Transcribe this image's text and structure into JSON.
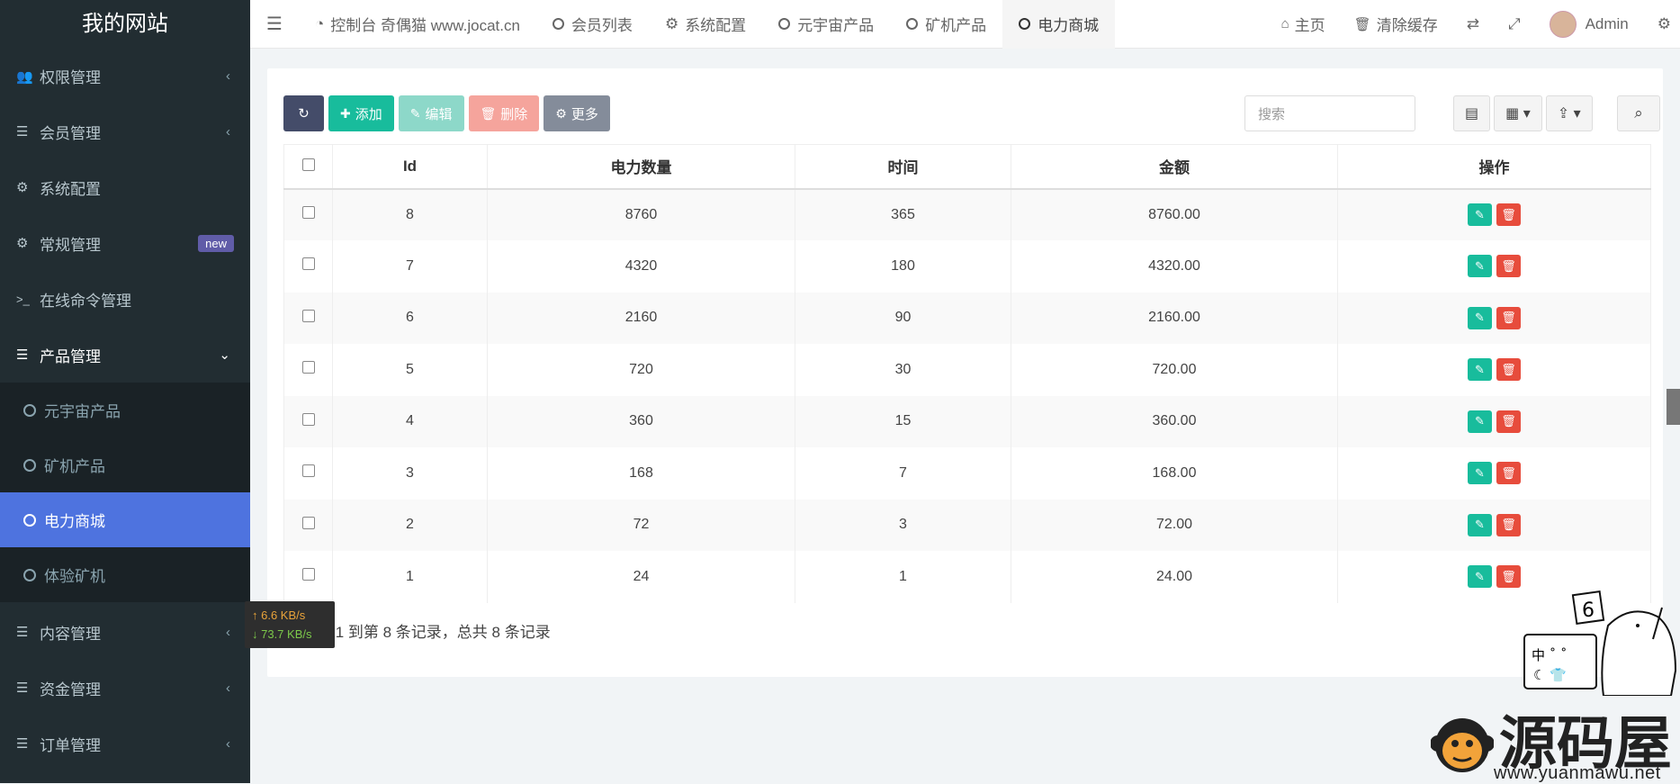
{
  "sidebar": {
    "logo": "我的网站",
    "menu": [
      {
        "label": "权限管理",
        "icon": "users-icon",
        "glyph": "👥",
        "chevron": "‹"
      },
      {
        "label": "会员管理",
        "icon": "list-icon",
        "glyph": "☰",
        "chevron": "‹"
      },
      {
        "label": "系统配置",
        "icon": "gear-icon",
        "glyph": "⚙",
        "chevron": ""
      },
      {
        "label": "常规管理",
        "icon": "gears-icon",
        "glyph": "⚙",
        "badge": "new"
      },
      {
        "label": "在线命令管理",
        "icon": "terminal-icon",
        "glyph": ">_",
        "chevron": ""
      },
      {
        "label": "产品管理",
        "icon": "list-icon",
        "glyph": "☰",
        "chevron": "⌄"
      }
    ],
    "submenu": [
      {
        "label": "元宇宙产品"
      },
      {
        "label": "矿机产品"
      },
      {
        "label": "电力商城"
      },
      {
        "label": "体验矿机"
      }
    ],
    "menu_after": [
      {
        "label": "内容管理",
        "glyph": "☰",
        "chevron": "‹"
      },
      {
        "label": "资金管理",
        "glyph": "☰",
        "chevron": "‹"
      },
      {
        "label": "订单管理",
        "glyph": "☰",
        "chevron": "‹"
      }
    ]
  },
  "topbar": {
    "tabs": [
      {
        "label": "控制台 奇偶猫 www.jocat.cn",
        "icon": "dashboard-icon"
      },
      {
        "label": "会员列表"
      },
      {
        "label": "系统配置",
        "icon": "gear-icon"
      },
      {
        "label": "元宇宙产品"
      },
      {
        "label": "矿机产品"
      },
      {
        "label": "电力商城"
      }
    ],
    "home": "主页",
    "clear_cache": "清除缓存",
    "user": "Admin"
  },
  "toolbar": {
    "add": "添加",
    "edit": "编辑",
    "delete": "删除",
    "more": "更多",
    "search_placeholder": "搜索"
  },
  "table": {
    "headers": [
      "Id",
      "电力数量",
      "时间",
      "金额",
      "操作"
    ],
    "rows": [
      [
        "8",
        "8760",
        "365",
        "8760.00"
      ],
      [
        "7",
        "4320",
        "180",
        "4320.00"
      ],
      [
        "6",
        "2160",
        "90",
        "2160.00"
      ],
      [
        "5",
        "720",
        "30",
        "720.00"
      ],
      [
        "4",
        "360",
        "15",
        "360.00"
      ],
      [
        "3",
        "168",
        "7",
        "168.00"
      ],
      [
        "2",
        "72",
        "3",
        "72.00"
      ],
      [
        "1",
        "24",
        "1",
        "24.00"
      ]
    ]
  },
  "pagination": {
    "info": "显示第 1 到第 8 条记录，总共 8 条记录"
  },
  "netspeed": {
    "up": "↑ 6.6 KB/s",
    "down": "↓ 73.7 KB/s"
  },
  "watermark": {
    "name": "源码屋",
    "url": "www.yuanmawu.net",
    "badge": "中 ˚ ˚"
  },
  "colors": {
    "sidebar": "#222d32",
    "active": "#4e73df",
    "success": "#18bc9c",
    "danger": "#e74c3c"
  }
}
